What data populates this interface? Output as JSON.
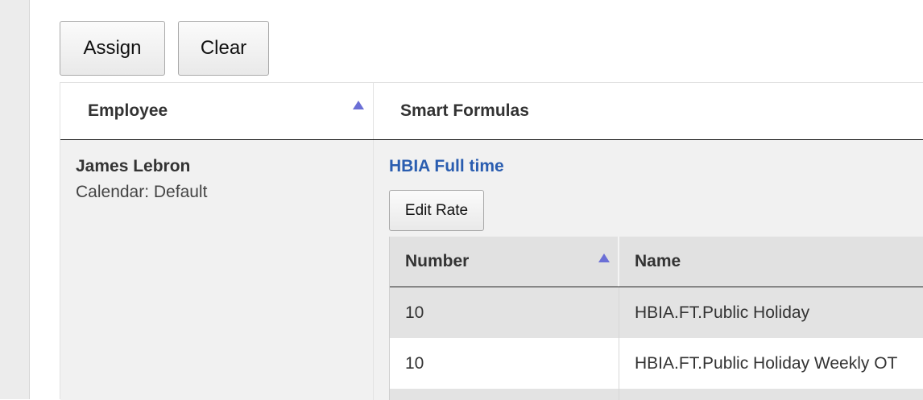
{
  "toolbar": {
    "assign_label": "Assign",
    "clear_label": "Clear"
  },
  "table": {
    "headers": {
      "employee": "Employee",
      "smart_formulas": "Smart Formulas"
    },
    "sort_icon": "sort-ascending-icon",
    "sort_color": "#6b6fd6",
    "rows": [
      {
        "employee_name": "James Lebron",
        "calendar": "Calendar: Default",
        "formula_name": "HBIA Full time",
        "edit_rate_label": "Edit Rate",
        "rates": {
          "headers": {
            "number": "Number",
            "name": "Name"
          },
          "rows": [
            {
              "number": "10",
              "name": "HBIA.FT.Public Holiday"
            },
            {
              "number": "10",
              "name": "HBIA.FT.Public Holiday Weekly OT"
            }
          ]
        }
      }
    ]
  },
  "colors": {
    "link": "#2a5db0",
    "row_alt": "#e3e3e3",
    "panel": "#f1f1f1"
  }
}
